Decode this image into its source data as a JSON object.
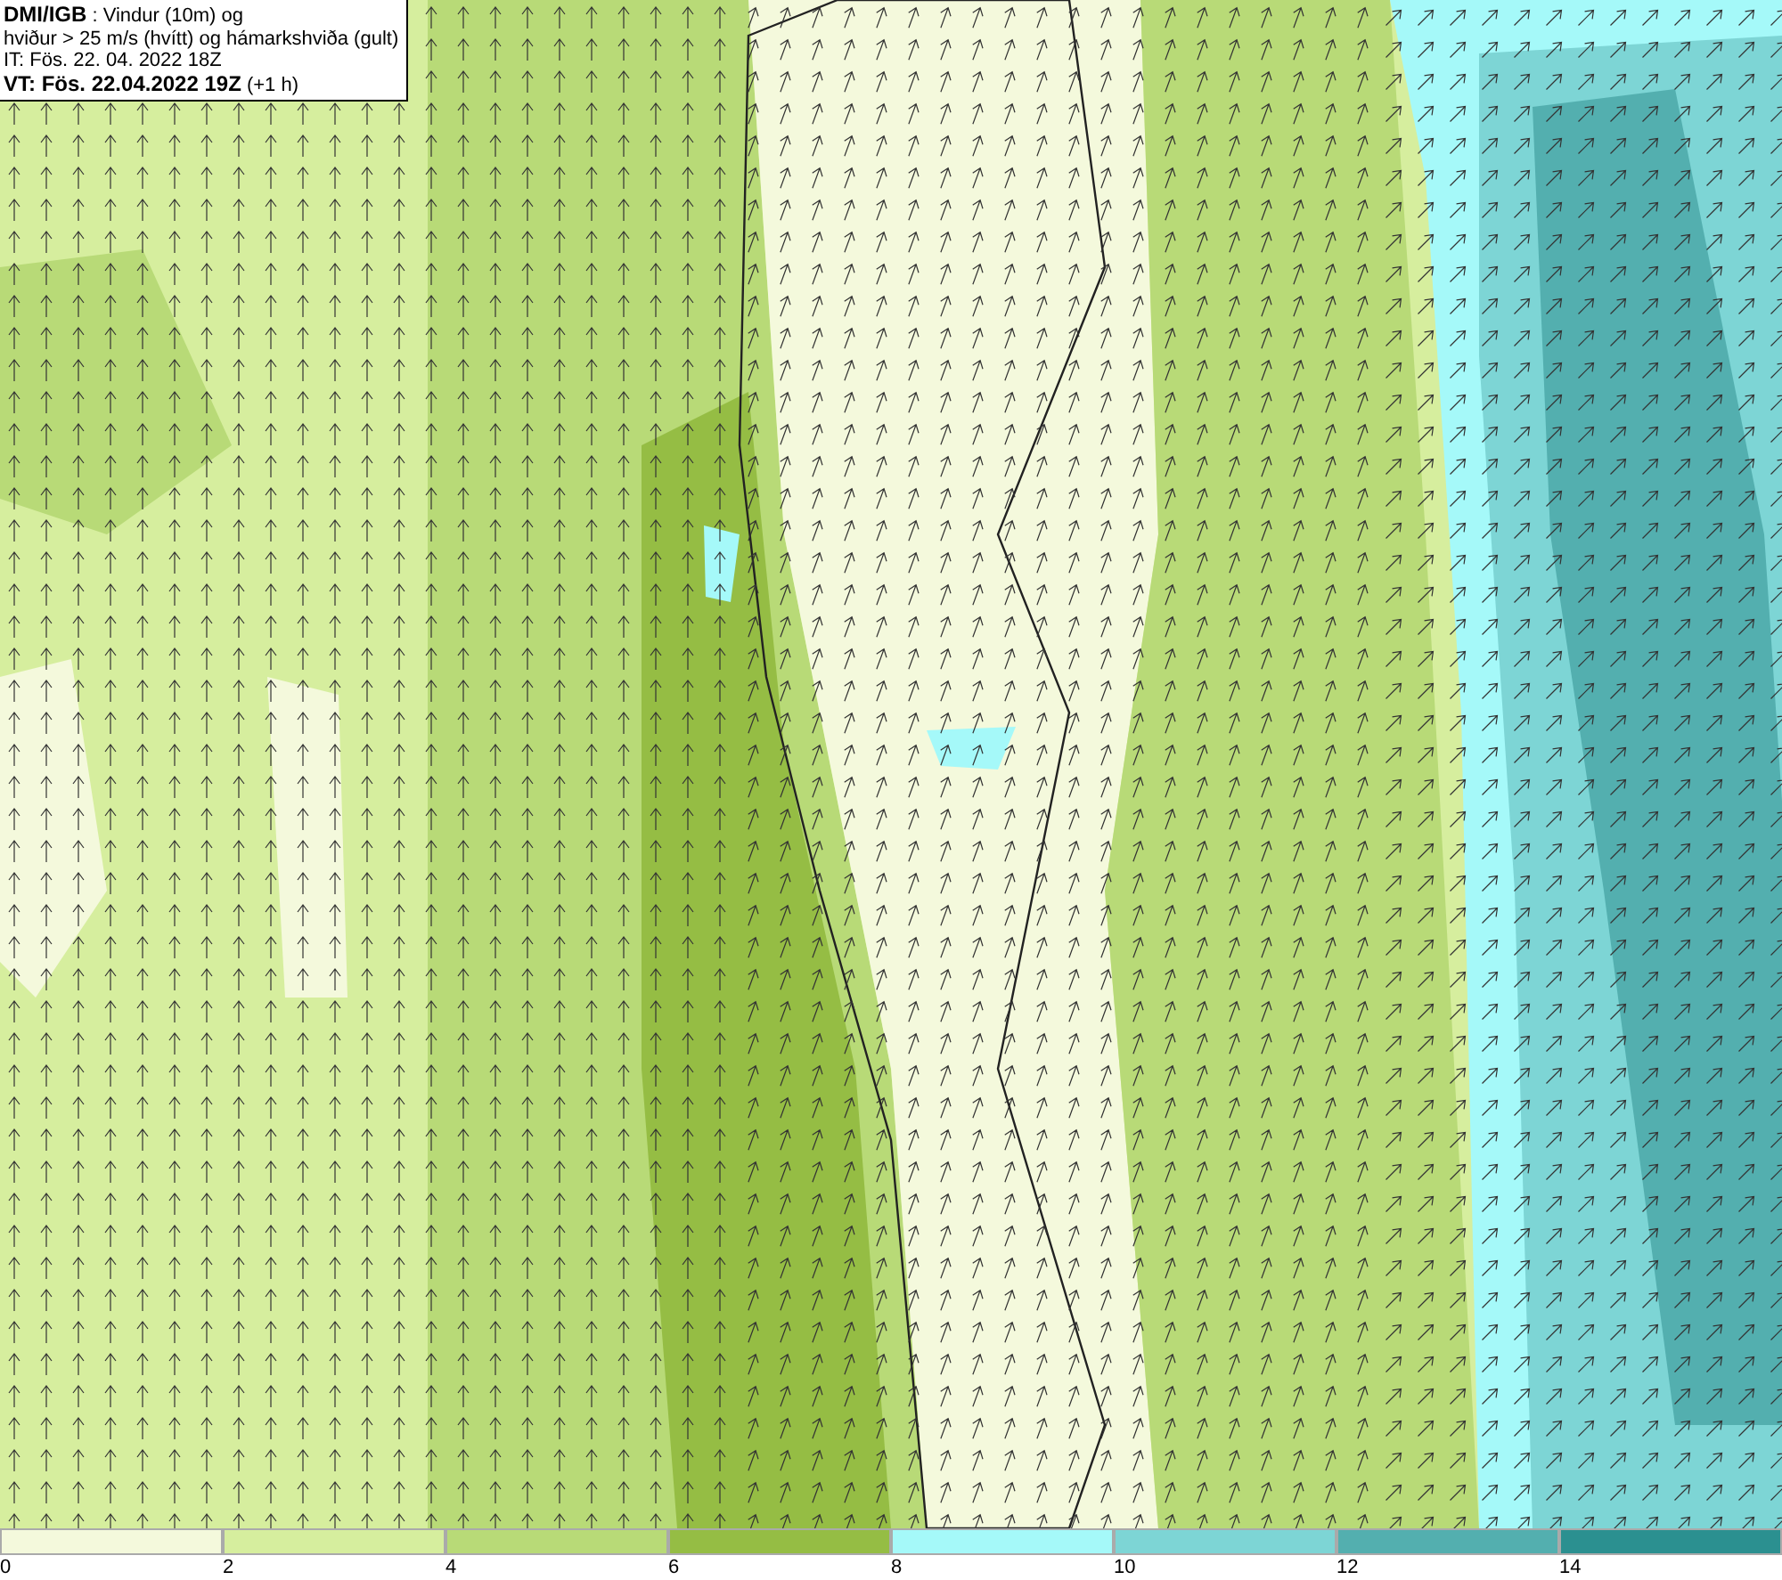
{
  "header": {
    "lines": [
      "**DMI/IGB** : Vindur (10m) og",
      "hviður > 25 m/s (hvítt) og hámarkshviða (gult)",
      "IT: Fös. 22. 04. 2022 18Z",
      "**VT: Fös. 22.04.2022 19Z** (+1 h)"
    ]
  },
  "legend": {
    "bins": [
      {
        "color": "#f4f9dc",
        "label": "0"
      },
      {
        "color": "#d6ee9e",
        "label": "2"
      },
      {
        "color": "#b8da77",
        "label": "4"
      },
      {
        "color": "#95bd44",
        "label": "6"
      },
      {
        "color": "#a5f9f9",
        "label": "8"
      },
      {
        "color": "#7dd5d5",
        "label": "10"
      },
      {
        "color": "#53afaf",
        "label": "12"
      },
      {
        "color": "#2b9090",
        "label": "14"
      }
    ]
  }
}
